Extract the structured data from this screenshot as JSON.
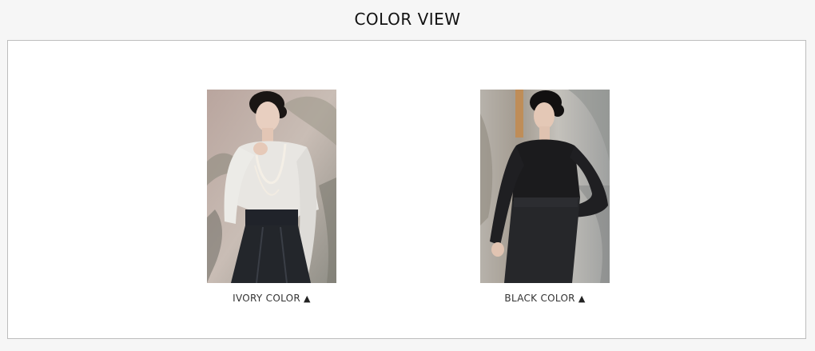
{
  "header": {
    "title": "COLOR VIEW"
  },
  "variants": [
    {
      "label": "IVORY COLOR",
      "arrow": "▲",
      "icon": "up-triangle-icon",
      "garment_color": "#e8e6e2",
      "skirt_color": "#23262b"
    },
    {
      "label": "BLACK COLOR",
      "arrow": "▲",
      "icon": "up-triangle-icon",
      "garment_color": "#1b1b1d",
      "skirt_color": "#26272a"
    }
  ],
  "colors": {
    "page_background": "#f6f6f6",
    "panel_border": "#bdbdbd",
    "text": "#111111"
  }
}
